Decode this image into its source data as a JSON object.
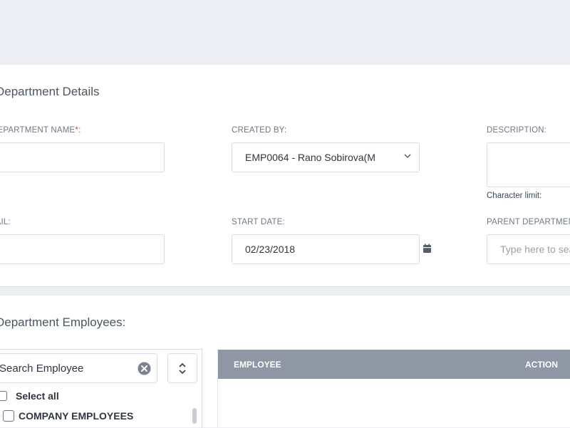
{
  "details": {
    "title": "Department Details",
    "department_name": {
      "label": "DEPARTMENT NAME",
      "required_mark": "*",
      "value": ""
    },
    "created_by": {
      "label": "CREATED BY:",
      "value": "EMP0064 - Rano Sobirova(M"
    },
    "description": {
      "label": "DESCRIPTION:",
      "value": "",
      "note": "Character limit:"
    },
    "email": {
      "label": "EMAIL:",
      "value": ""
    },
    "start_date": {
      "label": "START DATE:",
      "value": "02/23/2018"
    },
    "parent_department": {
      "label": "PARENT DEPARTMENT",
      "placeholder": "Type here to search"
    }
  },
  "employees": {
    "title": "Department Employees:",
    "search_value": "Search Employee",
    "select_all_label": "Select all",
    "groups": [
      {
        "label": "COMPANY EMPLOYEES"
      }
    ],
    "table": {
      "columns": [
        "EMPLOYEE",
        "ACTION"
      ],
      "rows": []
    }
  }
}
